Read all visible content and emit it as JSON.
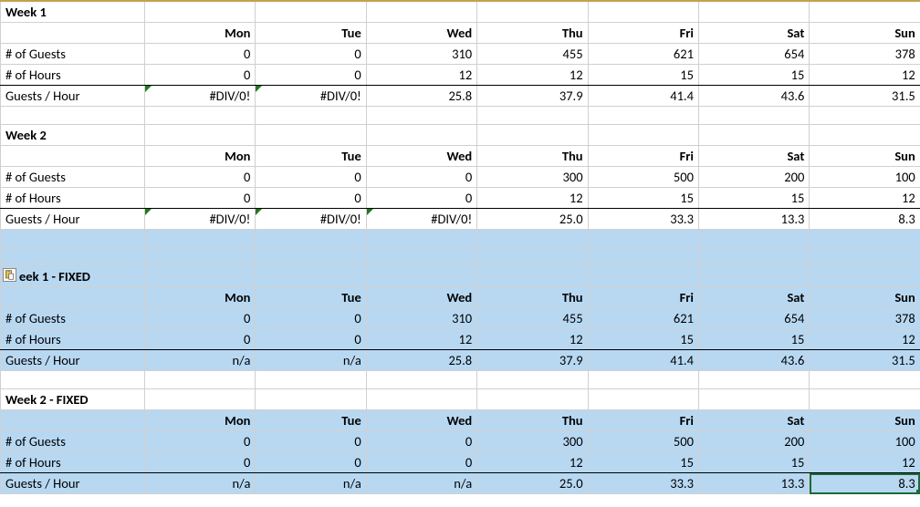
{
  "days": [
    "Mon",
    "Tue",
    "Wed",
    "Thu",
    "Fri",
    "Sat",
    "Sun"
  ],
  "week1": {
    "title": "Week 1",
    "rows": {
      "guests": {
        "label": "# of Guests",
        "v": [
          "0",
          "0",
          "310",
          "455",
          "621",
          "654",
          "378"
        ]
      },
      "hours": {
        "label": "# of Hours",
        "v": [
          "0",
          "0",
          "12",
          "12",
          "15",
          "15",
          "12"
        ]
      },
      "per": {
        "label": "Guests / Hour",
        "v": [
          "#DIV/0!",
          "#DIV/0!",
          "25.8",
          "37.9",
          "41.4",
          "43.6",
          "31.5"
        ]
      }
    }
  },
  "week2": {
    "title": "Week 2",
    "rows": {
      "guests": {
        "label": "# of Guests",
        "v": [
          "0",
          "0",
          "0",
          "300",
          "500",
          "200",
          "100"
        ]
      },
      "hours": {
        "label": "# of Hours",
        "v": [
          "0",
          "0",
          "0",
          "12",
          "15",
          "15",
          "12"
        ]
      },
      "per": {
        "label": "Guests / Hour",
        "v": [
          "#DIV/0!",
          "#DIV/0!",
          "#DIV/0!",
          "25.0",
          "33.3",
          "13.3",
          "8.3"
        ]
      }
    }
  },
  "week1f": {
    "title": "eek 1 - FIXED",
    "rows": {
      "guests": {
        "label": "# of Guests",
        "v": [
          "0",
          "0",
          "310",
          "455",
          "621",
          "654",
          "378"
        ]
      },
      "hours": {
        "label": "# of Hours",
        "v": [
          "0",
          "0",
          "12",
          "12",
          "15",
          "15",
          "12"
        ]
      },
      "per": {
        "label": "Guests / Hour",
        "v": [
          "n/a",
          "n/a",
          "25.8",
          "37.9",
          "41.4",
          "43.6",
          "31.5"
        ]
      }
    }
  },
  "week2f": {
    "title": "Week 2  - FIXED",
    "rows": {
      "guests": {
        "label": "# of Guests",
        "v": [
          "0",
          "0",
          "0",
          "300",
          "500",
          "200",
          "100"
        ]
      },
      "hours": {
        "label": "# of Hours",
        "v": [
          "0",
          "0",
          "0",
          "12",
          "15",
          "15",
          "12"
        ]
      },
      "per": {
        "label": "Guests / Hour",
        "v": [
          "n/a",
          "n/a",
          "n/a",
          "25.0",
          "33.3",
          "13.3",
          "8.3"
        ]
      }
    }
  },
  "chart_data": {
    "type": "table",
    "title": "Guests per Hour weekly breakdown with DIV/0 fix",
    "categories": [
      "Mon",
      "Tue",
      "Wed",
      "Thu",
      "Fri",
      "Sat",
      "Sun"
    ],
    "series": [
      {
        "name": "Week 1 # of Guests",
        "values": [
          0,
          0,
          310,
          455,
          621,
          654,
          378
        ]
      },
      {
        "name": "Week 1 # of Hours",
        "values": [
          0,
          0,
          12,
          12,
          15,
          15,
          12
        ]
      },
      {
        "name": "Week 1 Guests/Hour",
        "values": [
          null,
          null,
          25.8,
          37.9,
          41.4,
          43.6,
          31.5
        ]
      },
      {
        "name": "Week 2 # of Guests",
        "values": [
          0,
          0,
          0,
          300,
          500,
          200,
          100
        ]
      },
      {
        "name": "Week 2 # of Hours",
        "values": [
          0,
          0,
          0,
          12,
          15,
          15,
          12
        ]
      },
      {
        "name": "Week 2 Guests/Hour",
        "values": [
          null,
          null,
          null,
          25.0,
          33.3,
          13.3,
          8.3
        ]
      }
    ]
  }
}
